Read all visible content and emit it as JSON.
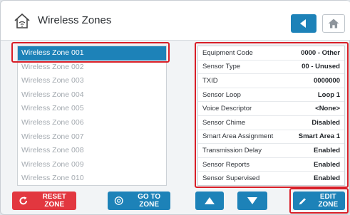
{
  "header": {
    "title": "Wireless Zones"
  },
  "zones": [
    "Wireless Zone 001",
    "Wireless Zone 002",
    "Wireless Zone 003",
    "Wireless Zone 004",
    "Wireless Zone 005",
    "Wireless Zone 006",
    "Wireless Zone 007",
    "Wireless Zone 008",
    "Wireless Zone 009",
    "Wireless Zone 010"
  ],
  "properties": [
    {
      "label": "Equipment Code",
      "value": "0000 - Other"
    },
    {
      "label": "Sensor Type",
      "value": "00 - Unused"
    },
    {
      "label": "TXID",
      "value": "0000000"
    },
    {
      "label": "Sensor Loop",
      "value": "Loop 1"
    },
    {
      "label": "Voice Descriptor",
      "value": "<None>"
    },
    {
      "label": "Sensor Chime",
      "value": "Disabled"
    },
    {
      "label": "Smart Area Assignment",
      "value": "Smart Area 1"
    },
    {
      "label": "Transmission Delay",
      "value": "Enabled"
    },
    {
      "label": "Sensor Reports",
      "value": "Enabled"
    },
    {
      "label": "Sensor Supervised",
      "value": "Enabled"
    }
  ],
  "buttons": {
    "reset": "RESET ZONE",
    "goto": "GO TO ZONE",
    "edit": "EDIT ZONE"
  },
  "colors": {
    "accent": "#1d82b8",
    "danger": "#e2373f",
    "highlight": "#d81e27"
  },
  "icons": {
    "header": "house-wifi-icon",
    "back": "back-arrow-icon",
    "home": "home-icon",
    "reset": "reset-icon",
    "goto": "target-icon",
    "up": "arrow-up-icon",
    "down": "arrow-down-icon",
    "edit": "pencil-icon"
  }
}
